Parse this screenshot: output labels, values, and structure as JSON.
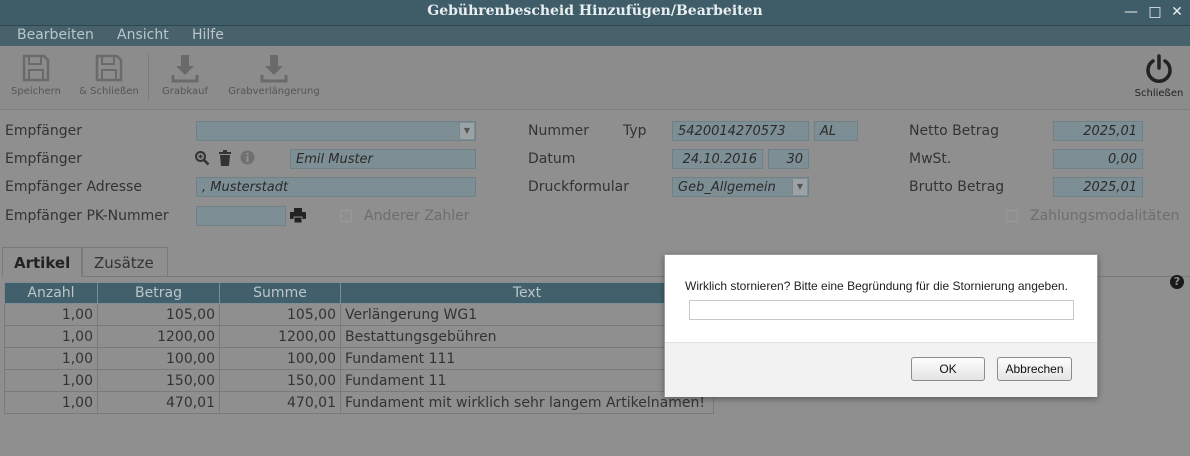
{
  "window": {
    "title": "Gebührenbescheid Hinzufügen/Bearbeiten"
  },
  "menu": [
    "Bearbeiten",
    "Ansicht",
    "Hilfe"
  ],
  "toolbar": {
    "save": "Speichern",
    "save_close": "& Schließen",
    "grabkauf": "Grabkauf",
    "grabverlaengerung": "Grabverlängerung",
    "close": "Schließen"
  },
  "form": {
    "empfaenger_label": "Empfänger",
    "empfaenger2_label": "Empfänger",
    "empfaenger_value": "Emil Muster",
    "adresse_label": "Empfänger Adresse",
    "adresse_value": ", Musterstadt",
    "pk_label": "Empfänger PK-Nummer",
    "anderer_zahler": "Anderer Zahler",
    "nummer_label": "Nummer",
    "typ_label": "Typ",
    "nummer_value": "5420014270573",
    "typ_value": "AL",
    "datum_label": "Datum",
    "datum_value": "24.10.2016",
    "datum_extra": "30",
    "druck_label": "Druckformular",
    "druck_value": "Geb_Allgemein",
    "netto_label": "Netto Betrag",
    "netto_value": "2025,01",
    "mwst_label": "MwSt.",
    "mwst_value": "0,00",
    "brutto_label": "Brutto Betrag",
    "brutto_value": "2025,01",
    "zahlungsmodalitaeten": "Zahlungsmodalitäten"
  },
  "tabs": [
    "Artikel",
    "Zusätze"
  ],
  "table": {
    "headers": [
      "Anzahl",
      "Betrag",
      "Summe",
      "Text"
    ],
    "rows": [
      [
        "1,00",
        "105,00",
        "105,00",
        "Verlängerung WG1"
      ],
      [
        "1,00",
        "1200,00",
        "1200,00",
        "Bestattungsgebühren"
      ],
      [
        "1,00",
        "100,00",
        "100,00",
        "Fundament 111"
      ],
      [
        "1,00",
        "150,00",
        "150,00",
        "Fundament 11"
      ],
      [
        "1,00",
        "470,01",
        "470,01",
        "Fundament mit wirklich sehr langem Artikelnamen!"
      ]
    ]
  },
  "dialog": {
    "message": "Wirklich stornieren? Bitte eine Begründung für die Stornierung angeben.",
    "input_value": "",
    "ok": "OK",
    "cancel": "Abbrechen"
  },
  "colors": {
    "header": "#42606b",
    "overlay": "#8f8f8f",
    "dialog": "#ffffff"
  }
}
